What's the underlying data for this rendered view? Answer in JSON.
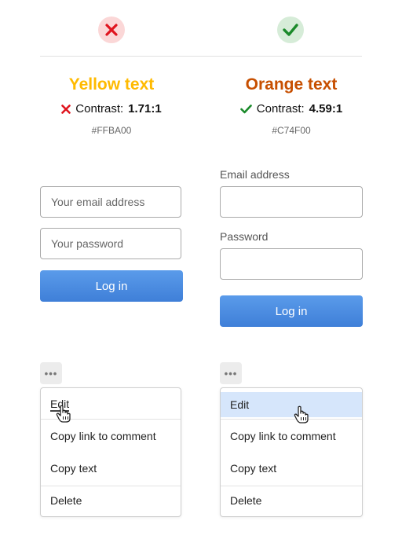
{
  "colors": {
    "yellow": "#FFBA00",
    "orange": "#C74F00",
    "bad": "#e0141e",
    "good": "#1a8a2a",
    "button": "#4a8ae0"
  },
  "left": {
    "status_icon": "cross-icon",
    "title": "Yellow text",
    "contrast_label": "Contrast:",
    "contrast_value": "1.71:1",
    "hex": "#FFBA00",
    "email_placeholder": "Your email address",
    "password_placeholder": "Your password",
    "login_label": "Log in",
    "menu": {
      "items": [
        "Edit",
        "Copy link to comment",
        "Copy text",
        "Delete"
      ]
    }
  },
  "right": {
    "status_icon": "checkmark-icon",
    "title": "Orange text",
    "contrast_label": "Contrast:",
    "contrast_value": "4.59:1",
    "hex": "#C74F00",
    "email_label": "Email address",
    "password_label": "Password",
    "login_label": "Log in",
    "menu": {
      "items": [
        "Edit",
        "Copy link to comment",
        "Copy text",
        "Delete"
      ]
    }
  },
  "more_button_icon": "more-dots-icon"
}
